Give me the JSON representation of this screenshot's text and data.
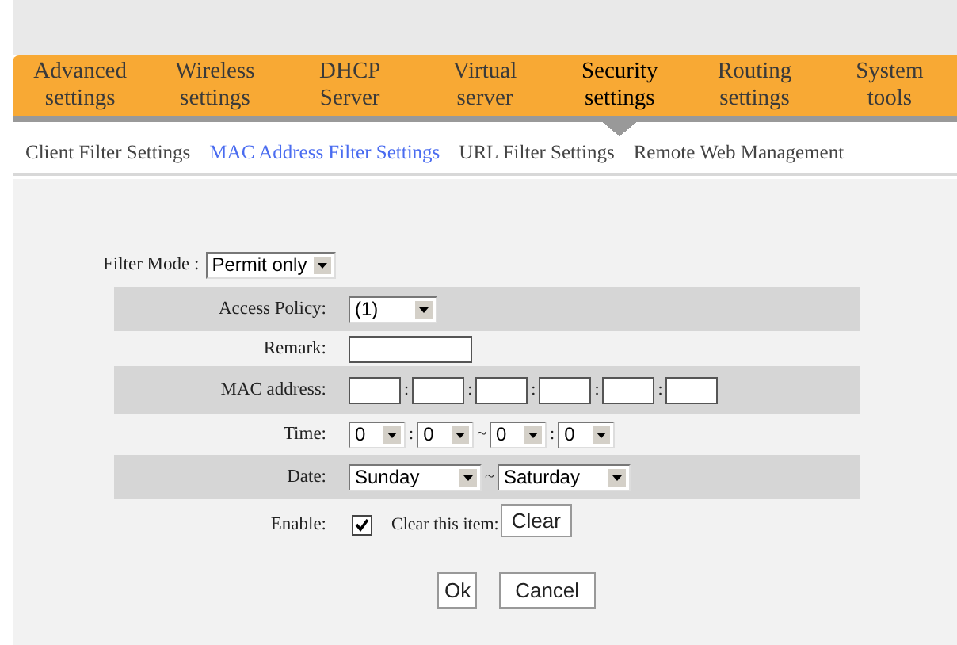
{
  "nav_tabs": [
    {
      "label": "Advanced\nsettings",
      "selected": false
    },
    {
      "label": "Wireless\nsettings",
      "selected": false
    },
    {
      "label": "DHCP\nServer",
      "selected": false
    },
    {
      "label": "Virtual\nserver",
      "selected": false
    },
    {
      "label": "Security\nsettings",
      "selected": true
    },
    {
      "label": "Routing\nsettings",
      "selected": false
    },
    {
      "label": "System\ntools",
      "selected": false
    }
  ],
  "sub_tabs": [
    {
      "label": "Client Filter Settings",
      "selected": false
    },
    {
      "label": "MAC Address Filter Settings",
      "selected": true
    },
    {
      "label": "URL Filter Settings",
      "selected": false
    },
    {
      "label": "Remote Web Management",
      "selected": false
    }
  ],
  "form": {
    "filter_mode": {
      "label": "Filter Mode :",
      "value": "Permit only"
    },
    "rows": [
      {
        "kind": "policy",
        "label": "Access Policy:",
        "selects": [
          "(1)"
        ],
        "separators": []
      },
      {
        "kind": "text",
        "label": "Remark:"
      },
      {
        "kind": "mac",
        "label": "MAC address:",
        "separators": [
          ":",
          ":",
          ":",
          ":",
          ":"
        ]
      },
      {
        "kind": "time",
        "label": "Time:",
        "selects": [
          "0",
          "0",
          "0",
          "0"
        ],
        "separators": [
          ":",
          "~",
          ":"
        ]
      },
      {
        "kind": "date",
        "label": "Date:",
        "selects": [
          "Sunday",
          "Saturday"
        ],
        "separators": [
          "~"
        ]
      },
      {
        "kind": "enable",
        "label": "Enable:",
        "checked": true,
        "clear_label": "Clear this item:",
        "clear_button": "Clear"
      }
    ],
    "buttons": [
      "Ok",
      "Cancel"
    ]
  }
}
